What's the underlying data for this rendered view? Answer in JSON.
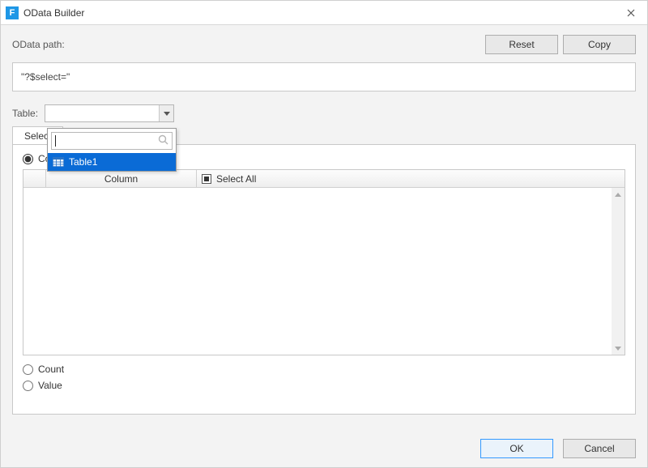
{
  "window": {
    "title": "OData Builder",
    "app_icon_letter": "F"
  },
  "labels": {
    "odata_path": "OData path:",
    "table": "Table:",
    "reset": "Reset",
    "copy": "Copy",
    "ok": "OK",
    "cancel": "Cancel"
  },
  "odata_value": "\"?$select=\"",
  "table_combo": {
    "value": "",
    "search_placeholder": ""
  },
  "table_dropdown": {
    "search_value": "",
    "items": [
      {
        "label": "Table1"
      }
    ]
  },
  "tabs": {
    "select": {
      "label": "Select"
    }
  },
  "options": {
    "columns": {
      "label": "Columns",
      "checked": true
    },
    "count": {
      "label": "Count",
      "checked": false
    },
    "value": {
      "label": "Value",
      "checked": false
    }
  },
  "grid": {
    "headers": {
      "column": "Column",
      "select_all": "Select All"
    },
    "rows": []
  }
}
